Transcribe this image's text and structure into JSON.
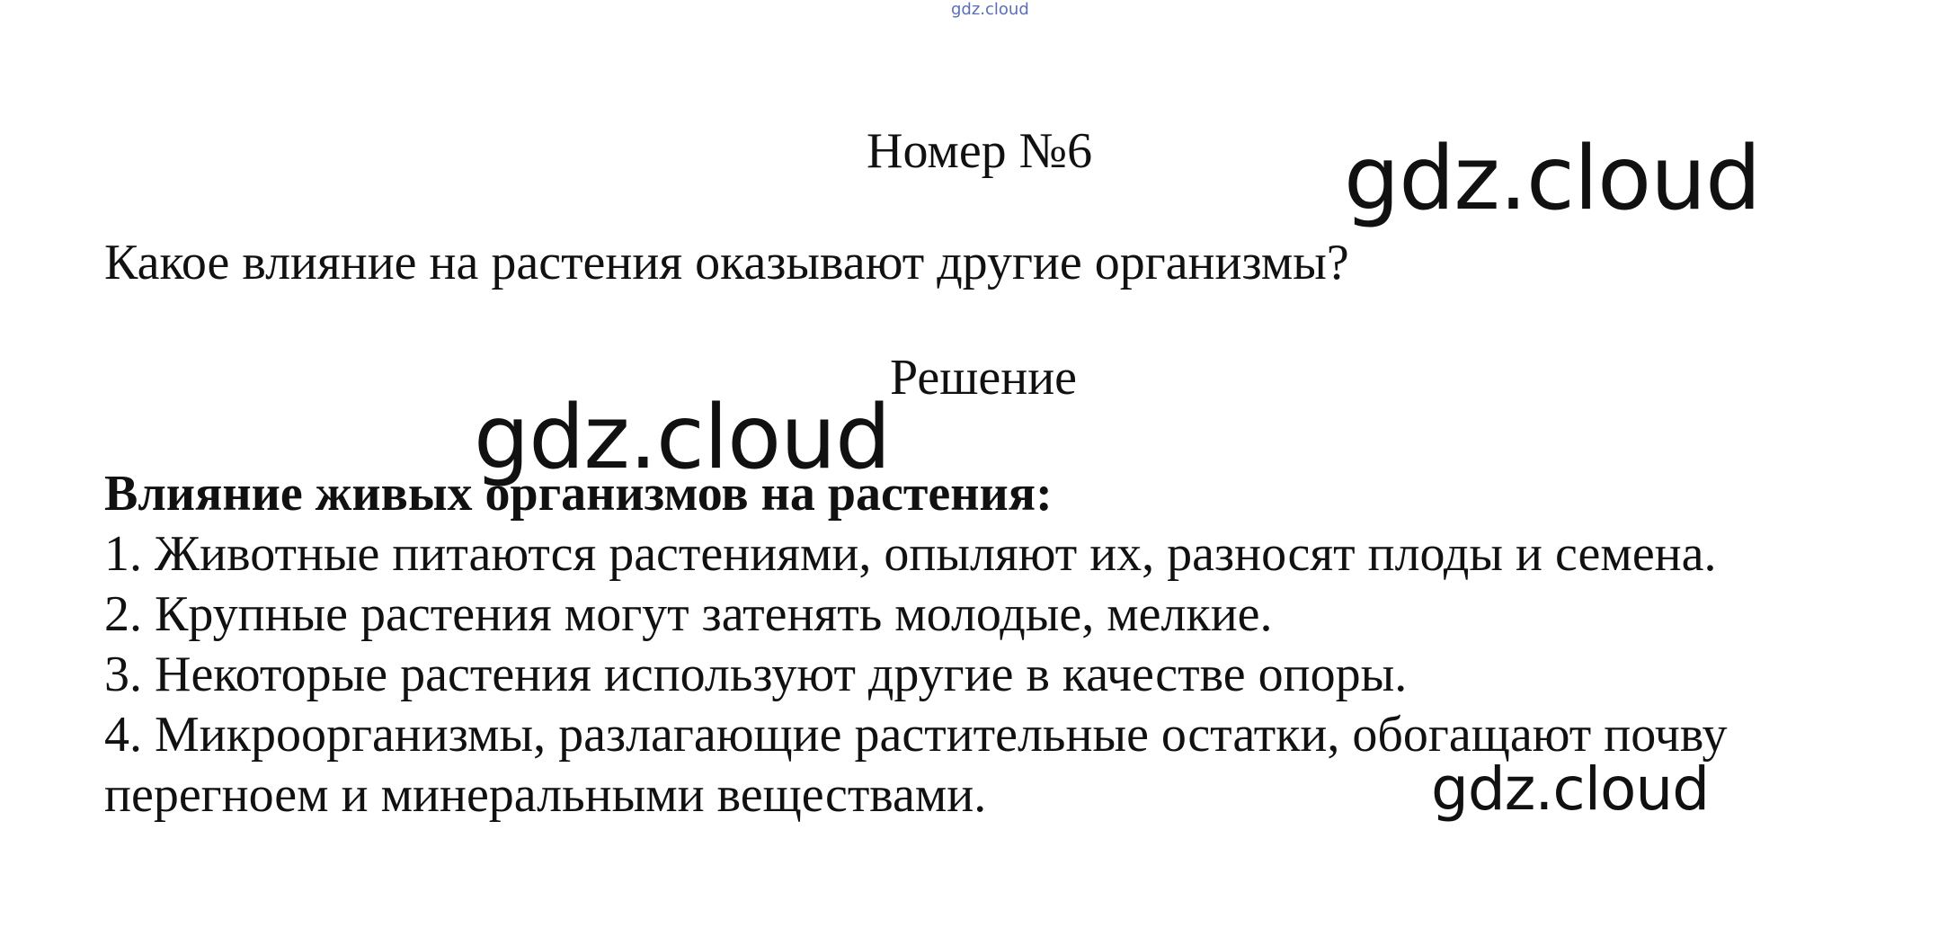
{
  "watermarks": {
    "top": "gdz.cloud",
    "main_1": "gdz.cloud",
    "main_2": "gdz.cloud",
    "main_3": "gdz.cloud"
  },
  "document": {
    "title": "Номер №6",
    "question": "Какое влияние на растения оказывают другие организмы?",
    "solution_label": "Решение",
    "answer_heading": "Влияние живых организмов на растения:",
    "answer_items": [
      "1. Животные питаются растениями, опыляют их, разносят плоды и семена.",
      "2. Крупные растения могут затенять молодые, мелкие.",
      "3. Некоторые растения используют другие в качестве опоры.",
      "4. Микроорганизмы, разлагающие растительные остатки, обогащают почву",
      "перегноем и минеральными веществами."
    ]
  }
}
